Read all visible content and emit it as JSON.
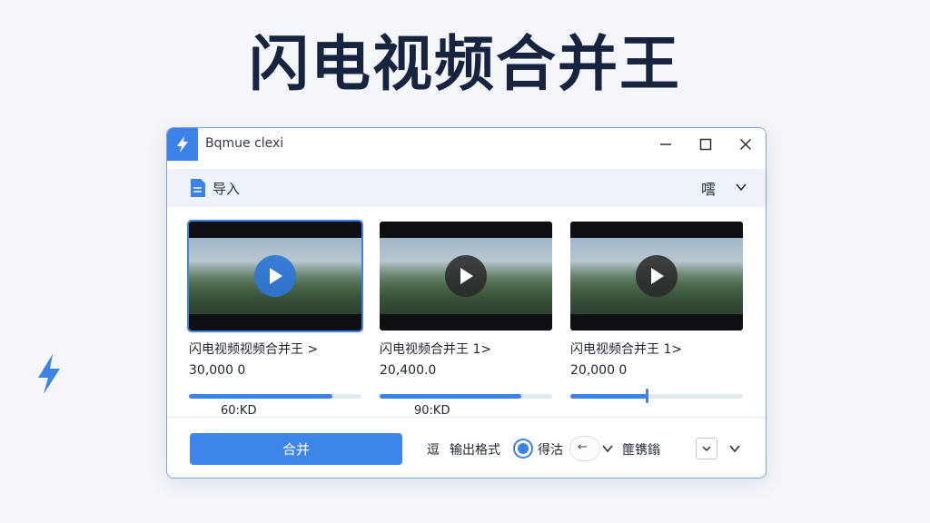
{
  "hero": {
    "title": "闪电视频合并王"
  },
  "window": {
    "title": "Bqmue clexi",
    "toolbar": {
      "import_label": "导入",
      "right_label": "㘊"
    },
    "videos": [
      {
        "title": "闪电视频视频合并王 >",
        "size": "30,000 0",
        "progress": 0.83,
        "rate": "60:KD",
        "selected": true
      },
      {
        "title": "闪电视频合并王 1>",
        "size": "20,400.0",
        "progress": 0.82,
        "rate": "90:KD",
        "selected": false
      },
      {
        "title": "闪电视频合并王 1>",
        "size": "20,000 0",
        "progress": 0.44,
        "rate": "",
        "selected": false
      }
    ],
    "bottom": {
      "merge_label": "合并",
      "item1_label": "逗",
      "format_label": "输出格式",
      "option_label": "得沽",
      "pill_label": "←",
      "item2_label": "篚镌鎓"
    }
  },
  "colors": {
    "accent": "#3d82e6",
    "title": "#17243f",
    "background": "#f4f6fa"
  },
  "icons": [
    "lightning-bolt-icon",
    "minimize-icon",
    "maximize-icon",
    "close-icon",
    "file-icon",
    "chevron-down-icon",
    "play-icon"
  ]
}
